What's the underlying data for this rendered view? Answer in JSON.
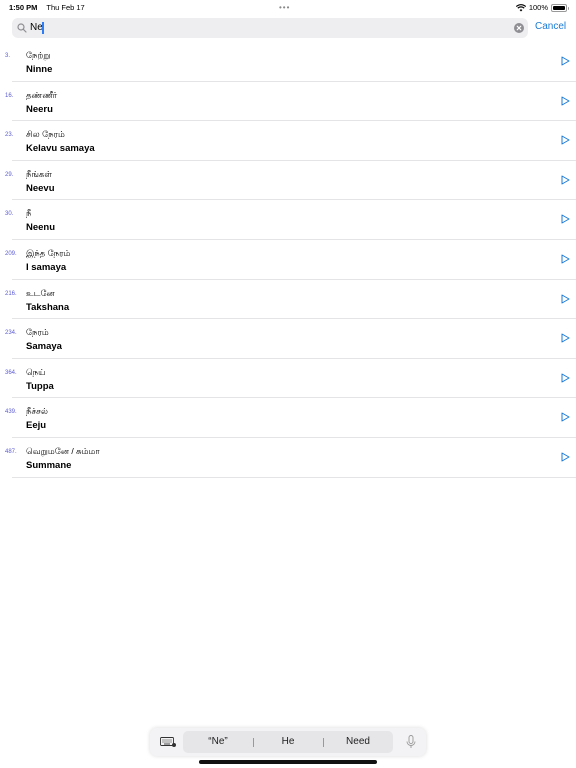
{
  "status_bar": {
    "time": "1:50 PM",
    "date": "Thu Feb 17",
    "dots": "•••",
    "battery_percent": "100%",
    "battery_level": 1.0
  },
  "search": {
    "value": "Ne",
    "cancel_label": "Cancel"
  },
  "results": [
    {
      "num": "3.",
      "tamil": "நேற்று",
      "translit": "Ninne"
    },
    {
      "num": "16.",
      "tamil": "தண்ணீர்",
      "translit": "Neeru"
    },
    {
      "num": "23.",
      "tamil": "சில நேரம்",
      "translit": "Kelavu samaya"
    },
    {
      "num": "29.",
      "tamil": "நீங்கள்",
      "translit": "Neevu"
    },
    {
      "num": "30.",
      "tamil": "நீ",
      "translit": "Neenu"
    },
    {
      "num": "209.",
      "tamil": "இந்த நேரம்",
      "translit": "I samaya"
    },
    {
      "num": "216.",
      "tamil": "உடனே",
      "translit": "Takshana"
    },
    {
      "num": "234.",
      "tamil": "நேரம்",
      "translit": "Samaya"
    },
    {
      "num": "364.",
      "tamil": "நெய்",
      "translit": "Tuppa"
    },
    {
      "num": "439.",
      "tamil": "நீச்சல்",
      "translit": "Eeju"
    },
    {
      "num": "487.",
      "tamil": "வெறுமனே / சும்மா",
      "translit": "Summane"
    }
  ],
  "keyboard": {
    "suggestions": [
      "“Ne”",
      "He",
      "Need"
    ]
  },
  "colors": {
    "accent": "#1a7bd6",
    "number": "#5b5bd6",
    "play": "#1a7bd6"
  }
}
